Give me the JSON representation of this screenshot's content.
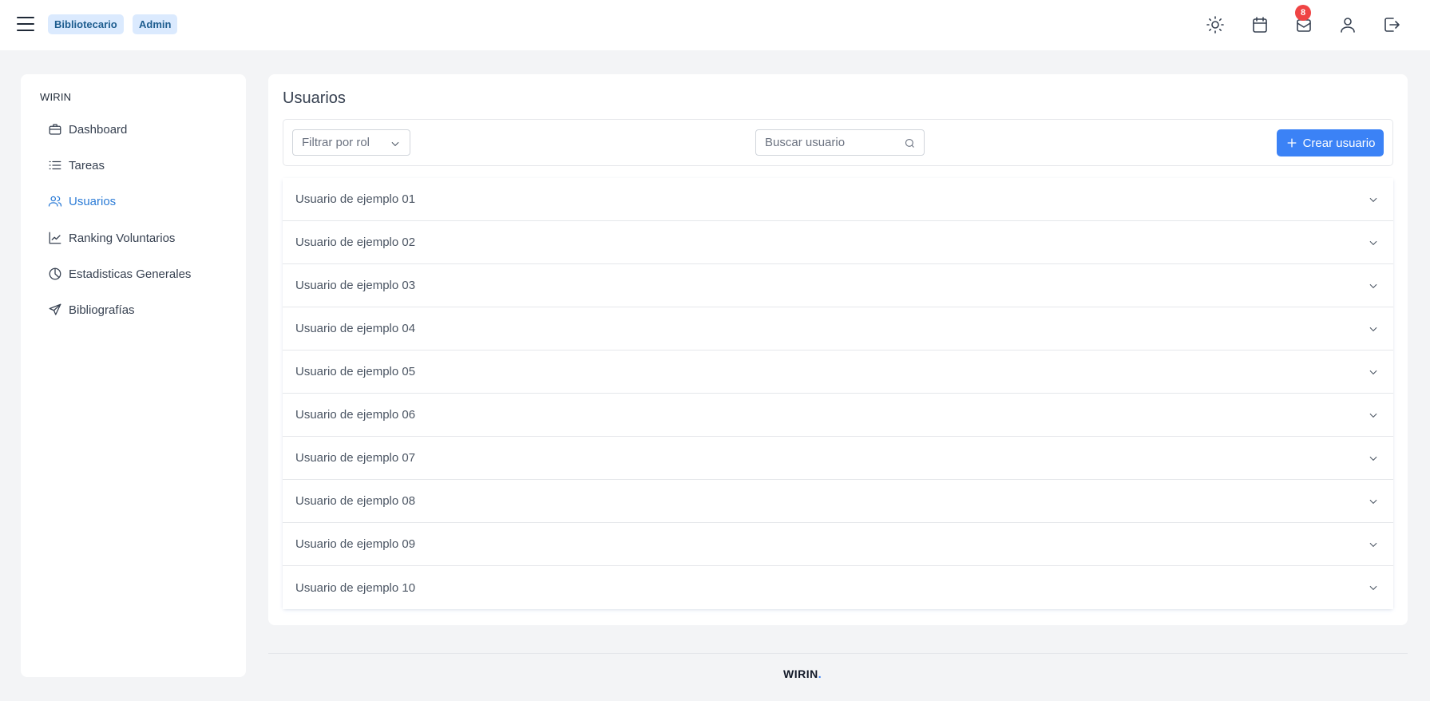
{
  "header": {
    "roles": [
      "Bibliotecario",
      "Admin"
    ],
    "notifications_count": "8"
  },
  "sidebar": {
    "title": "WIRIN",
    "items": [
      {
        "label": "Dashboard",
        "icon": "briefcase-icon"
      },
      {
        "label": "Tareas",
        "icon": "list-icon"
      },
      {
        "label": "Usuarios",
        "icon": "users-icon",
        "active": true
      },
      {
        "label": "Ranking Voluntarios",
        "icon": "trending-up-icon"
      },
      {
        "label": "Estadisticas Generales",
        "icon": "pie-chart-icon"
      },
      {
        "label": "Bibliografías",
        "icon": "send-icon"
      }
    ]
  },
  "main": {
    "title": "Usuarios",
    "filter_placeholder": "Filtrar por rol",
    "search_placeholder": "Buscar usuario",
    "create_label": "Crear usuario",
    "users": [
      "Usuario de ejemplo 01",
      "Usuario de ejemplo 02",
      "Usuario de ejemplo 03",
      "Usuario de ejemplo 04",
      "Usuario de ejemplo 05",
      "Usuario de ejemplo 06",
      "Usuario de ejemplo 07",
      "Usuario de ejemplo 08",
      "Usuario de ejemplo 09",
      "Usuario de ejemplo 10"
    ]
  },
  "footer": {
    "brand": "WIRIN",
    "brand_dot": "."
  },
  "colors": {
    "accent": "#3b82f6",
    "active_nav": "#2b7bd6",
    "badge_bg": "#dbeafe",
    "notification": "#ef4444"
  }
}
